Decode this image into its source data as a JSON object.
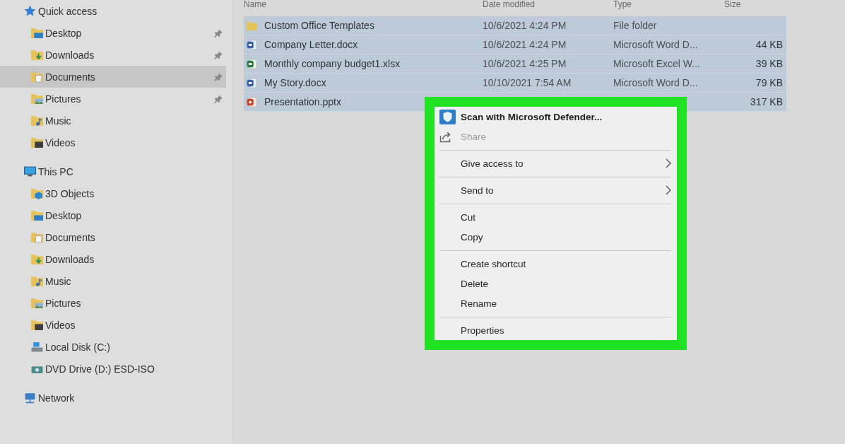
{
  "sidebar": {
    "items": [
      {
        "label": "Quick access",
        "kind": "quickaccess",
        "selected": false,
        "children": [
          {
            "label": "Desktop",
            "kind": "desktop",
            "pinned": true,
            "selected": false
          },
          {
            "label": "Downloads",
            "kind": "downloads",
            "pinned": true,
            "selected": false
          },
          {
            "label": "Documents",
            "kind": "documents",
            "pinned": true,
            "selected": true
          },
          {
            "label": "Pictures",
            "kind": "pictures",
            "pinned": true,
            "selected": false
          },
          {
            "label": "Music",
            "kind": "music",
            "pinned": false,
            "selected": false
          },
          {
            "label": "Videos",
            "kind": "videos",
            "pinned": false,
            "selected": false
          }
        ]
      },
      {
        "label": "This PC",
        "kind": "computer",
        "selected": false,
        "children": [
          {
            "label": "3D Objects",
            "kind": "objects",
            "selected": false
          },
          {
            "label": "Desktop",
            "kind": "desktop",
            "selected": false
          },
          {
            "label": "Documents",
            "kind": "documents",
            "selected": false
          },
          {
            "label": "Downloads",
            "kind": "downloads",
            "selected": false
          },
          {
            "label": "Music",
            "kind": "music",
            "selected": false
          },
          {
            "label": "Pictures",
            "kind": "pictures",
            "selected": false
          },
          {
            "label": "Videos",
            "kind": "videos",
            "selected": false
          },
          {
            "label": "Local Disk (C:)",
            "kind": "drive",
            "selected": false
          },
          {
            "label": "DVD Drive (D:) ESD-ISO",
            "kind": "disc",
            "selected": false
          }
        ]
      },
      {
        "label": "Network",
        "kind": "network",
        "selected": false
      }
    ]
  },
  "files": {
    "columns": [
      "Name",
      "Date modified",
      "Type",
      "Size"
    ],
    "rows": [
      {
        "name": "Custom Office Templates",
        "kind": "folder",
        "date": "10/6/2021 4:24 PM",
        "type": "File folder",
        "selected": true
      },
      {
        "name": "Company Letter.docx",
        "kind": "document",
        "date": "10/6/2021 4:24 PM",
        "type": "Microsoft Word D...",
        "size": "44 KB",
        "selected": true
      },
      {
        "name": "Monthly company budget1.xlsx",
        "kind": "spreadsheet",
        "date": "10/6/2021 4:25 PM",
        "type": "Microsoft Excel W...",
        "size": "39 KB",
        "selected": true
      },
      {
        "name": "My Story.docx",
        "kind": "document",
        "date": "10/10/2021 7:54 AM",
        "type": "Microsoft Word D...",
        "size": "79 KB",
        "selected": true
      },
      {
        "name": "Presentation.pptx",
        "kind": "presentation",
        "size": "317 KB",
        "selected": true
      }
    ]
  },
  "context_menu": {
    "items": [
      {
        "kind": "shield",
        "label": "Scan with Microsoft Defender...",
        "default": true,
        "disabled": false,
        "submenu": false
      },
      {
        "kind": "share",
        "label": "Share",
        "default": false,
        "disabled": true,
        "submenu": false
      },
      {
        "kind": "separator"
      },
      {
        "kind": "text",
        "label": "Give access to",
        "default": false,
        "disabled": false,
        "submenu": true
      },
      {
        "kind": "separator"
      },
      {
        "kind": "text",
        "label": "Send to",
        "default": false,
        "disabled": false,
        "submenu": true
      },
      {
        "kind": "separator"
      },
      {
        "kind": "text",
        "label": "Cut",
        "default": false,
        "disabled": false,
        "submenu": false
      },
      {
        "kind": "text",
        "label": "Copy",
        "default": false,
        "disabled": false,
        "submenu": false
      },
      {
        "kind": "separator"
      },
      {
        "kind": "text",
        "label": "Create shortcut",
        "default": false,
        "disabled": false,
        "submenu": false
      },
      {
        "kind": "text",
        "label": "Delete",
        "default": false,
        "disabled": false,
        "submenu": false
      },
      {
        "kind": "text",
        "label": "Rename",
        "default": false,
        "disabled": false,
        "submenu": false
      },
      {
        "kind": "separator"
      },
      {
        "kind": "text",
        "label": "Properties",
        "default": false,
        "disabled": false,
        "submenu": false
      }
    ]
  }
}
